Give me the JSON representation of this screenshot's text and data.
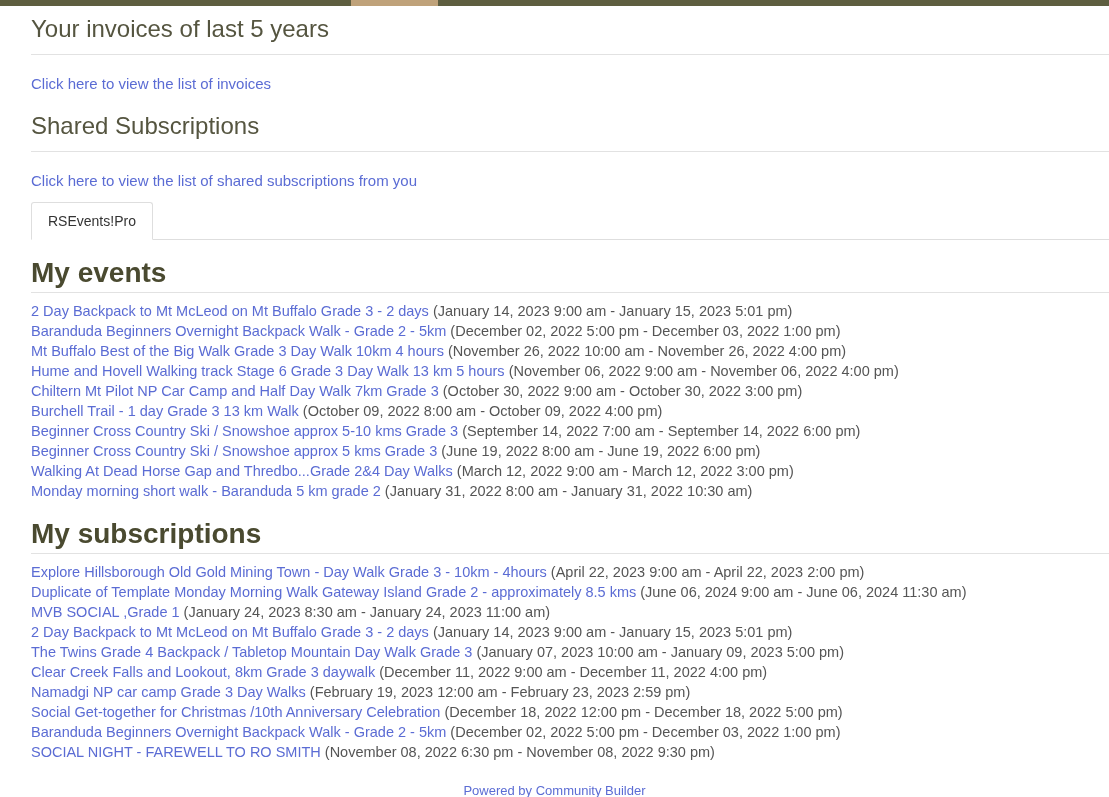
{
  "invoices": {
    "title": "Your invoices of last 5 years",
    "link": "Click here to view the list of invoices"
  },
  "shared": {
    "title": "Shared Subscriptions",
    "link": "Click here to view the list of shared subscriptions from you"
  },
  "tabs": [
    {
      "label": "RSEvents!Pro",
      "selected": true
    }
  ],
  "my_events": {
    "title": "My events",
    "items": [
      {
        "name": "2 Day Backpack to Mt McLeod on Mt Buffalo Grade 3 - 2 days",
        "dates": "(January 14, 2023 9:00 am - January 15, 2023 5:01 pm)"
      },
      {
        "name": "Baranduda Beginners Overnight Backpack Walk - Grade 2 - 5km",
        "dates": "(December 02, 2022 5:00 pm - December 03, 2022 1:00 pm)"
      },
      {
        "name": "Mt Buffalo Best of the Big Walk Grade 3 Day Walk 10km 4 hours",
        "dates": "(November 26, 2022 10:00 am - November 26, 2022 4:00 pm)"
      },
      {
        "name": "Hume and Hovell Walking track Stage 6 Grade 3 Day Walk 13 km 5 hours",
        "dates": "(November 06, 2022 9:00 am - November 06, 2022 4:00 pm)"
      },
      {
        "name": "Chiltern Mt Pilot NP Car Camp and Half Day Walk 7km Grade 3",
        "dates": "(October 30, 2022 9:00 am - October 30, 2022 3:00 pm)"
      },
      {
        "name": "Burchell Trail - 1 day Grade 3 13 km Walk",
        "dates": "(October 09, 2022 8:00 am - October 09, 2022 4:00 pm)"
      },
      {
        "name": "Beginner Cross Country Ski / Snowshoe approx 5-10 kms Grade 3",
        "dates": "(September 14, 2022 7:00 am - September 14, 2022 6:00 pm)"
      },
      {
        "name": "Beginner Cross Country Ski / Snowshoe approx 5 kms Grade 3",
        "dates": "(June 19, 2022 8:00 am - June 19, 2022 6:00 pm)"
      },
      {
        "name": "Walking At Dead Horse Gap and Thredbo...Grade 2&4 Day Walks",
        "dates": "(March 12, 2022 9:00 am - March 12, 2022 3:00 pm)"
      },
      {
        "name": "Monday morning short walk - Baranduda 5 km grade 2",
        "dates": "(January 31, 2022 8:00 am - January 31, 2022 10:30 am)"
      }
    ]
  },
  "my_subscriptions": {
    "title": "My subscriptions",
    "items": [
      {
        "name": "Explore Hillsborough Old Gold Mining Town - Day Walk Grade 3 - 10km - 4hours",
        "dates": "(April 22, 2023 9:00 am - April 22, 2023 2:00 pm)"
      },
      {
        "name": "Duplicate of Template Monday Morning Walk Gateway Island Grade 2 - approximately 8.5 kms",
        "dates": "(June 06, 2024 9:00 am - June 06, 2024 11:30 am)"
      },
      {
        "name": "MVB SOCIAL ,Grade 1",
        "dates": "(January 24, 2023 8:30 am - January 24, 2023 11:00 am)"
      },
      {
        "name": "2 Day Backpack to Mt McLeod on Mt Buffalo Grade 3 - 2 days",
        "dates": "(January 14, 2023 9:00 am - January 15, 2023 5:01 pm)"
      },
      {
        "name": "The Twins Grade 4 Backpack / Tabletop Mountain Day Walk Grade 3",
        "dates": "(January 07, 2023 10:00 am - January 09, 2023 5:00 pm)"
      },
      {
        "name": "Clear Creek Falls and Lookout, 8km Grade 3 daywalk",
        "dates": "(December 11, 2022 9:00 am - December 11, 2022 4:00 pm)"
      },
      {
        "name": "Namadgi NP car camp Grade 3 Day Walks",
        "dates": "(February 19, 2023 12:00 am - February 23, 2023 2:59 pm)"
      },
      {
        "name": "Social Get-together for Christmas /10th Anniversary Celebration",
        "dates": "(December 18, 2022 12:00 pm - December 18, 2022 5:00 pm)"
      },
      {
        "name": "Baranduda Beginners Overnight Backpack Walk - Grade 2 - 5km",
        "dates": "(December 02, 2022 5:00 pm - December 03, 2022 1:00 pm)"
      },
      {
        "name": "SOCIAL NIGHT - FAREWELL TO RO SMITH",
        "dates": "(November 08, 2022 6:30 pm - November 08, 2022 9:30 pm)"
      }
    ]
  },
  "footer": "Powered by Community Builder"
}
